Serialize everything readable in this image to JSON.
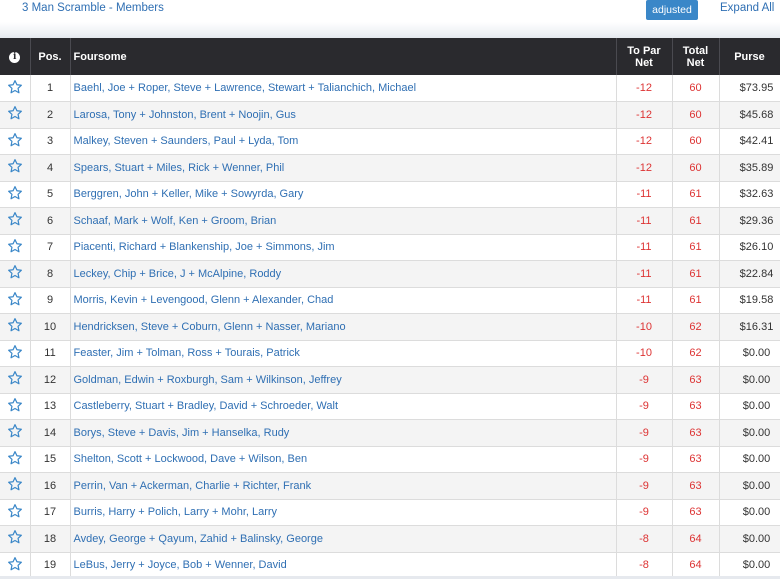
{
  "header": {
    "title": "3 Man Scramble - Members",
    "adjusted_label": "adjusted",
    "expand_label": "Expand All"
  },
  "table": {
    "columns": {
      "info": "i",
      "pos": "Pos.",
      "foursome": "Foursome",
      "to_par_line1": "To Par",
      "to_par_line2": "Net",
      "total_line1": "Total",
      "total_line2": "Net",
      "purse": "Purse"
    },
    "rows": [
      {
        "pos": "1",
        "team": "Baehl, Joe + Roper, Steve + Lawrence, Stewart + Talianchich, Michael",
        "to_par": "-12",
        "total": "60",
        "purse": "$73.95"
      },
      {
        "pos": "2",
        "team": "Larosa, Tony + Johnston, Brent + Noojin, Gus",
        "to_par": "-12",
        "total": "60",
        "purse": "$45.68"
      },
      {
        "pos": "3",
        "team": "Malkey, Steven + Saunders, Paul + Lyda, Tom",
        "to_par": "-12",
        "total": "60",
        "purse": "$42.41"
      },
      {
        "pos": "4",
        "team": "Spears, Stuart + Miles, Rick + Wenner, Phil",
        "to_par": "-12",
        "total": "60",
        "purse": "$35.89"
      },
      {
        "pos": "5",
        "team": "Berggren, John + Keller, Mike + Sowyrda, Gary",
        "to_par": "-11",
        "total": "61",
        "purse": "$32.63"
      },
      {
        "pos": "6",
        "team": "Schaaf, Mark + Wolf, Ken + Groom, Brian",
        "to_par": "-11",
        "total": "61",
        "purse": "$29.36"
      },
      {
        "pos": "7",
        "team": "Piacenti, Richard + Blankenship, Joe + Simmons, Jim",
        "to_par": "-11",
        "total": "61",
        "purse": "$26.10"
      },
      {
        "pos": "8",
        "team": "Leckey, Chip + Brice, J + McAlpine, Roddy",
        "to_par": "-11",
        "total": "61",
        "purse": "$22.84"
      },
      {
        "pos": "9",
        "team": "Morris, Kevin + Levengood, Glenn + Alexander, Chad",
        "to_par": "-11",
        "total": "61",
        "purse": "$19.58"
      },
      {
        "pos": "10",
        "team": "Hendricksen, Steve + Coburn, Glenn + Nasser, Mariano",
        "to_par": "-10",
        "total": "62",
        "purse": "$16.31"
      },
      {
        "pos": "11",
        "team": "Feaster, Jim + Tolman, Ross + Tourais, Patrick",
        "to_par": "-10",
        "total": "62",
        "purse": "$0.00"
      },
      {
        "pos": "12",
        "team": "Goldman, Edwin + Roxburgh, Sam + Wilkinson, Jeffrey",
        "to_par": "-9",
        "total": "63",
        "purse": "$0.00"
      },
      {
        "pos": "13",
        "team": "Castleberry, Stuart + Bradley, David + Schroeder, Walt",
        "to_par": "-9",
        "total": "63",
        "purse": "$0.00"
      },
      {
        "pos": "14",
        "team": "Borys, Steve + Davis, Jim + Hanselka, Rudy",
        "to_par": "-9",
        "total": "63",
        "purse": "$0.00"
      },
      {
        "pos": "15",
        "team": "Shelton, Scott + Lockwood, Dave + Wilson, Ben",
        "to_par": "-9",
        "total": "63",
        "purse": "$0.00"
      },
      {
        "pos": "16",
        "team": "Perrin, Van + Ackerman, Charlie + Richter, Frank",
        "to_par": "-9",
        "total": "63",
        "purse": "$0.00"
      },
      {
        "pos": "17",
        "team": "Burris, Harry + Polich, Larry + Mohr, Larry",
        "to_par": "-9",
        "total": "63",
        "purse": "$0.00"
      },
      {
        "pos": "18",
        "team": "Avdey, George + Qayum, Zahid + Balinsky, George",
        "to_par": "-8",
        "total": "64",
        "purse": "$0.00"
      },
      {
        "pos": "19",
        "team": "LeBus, Jerry + Joyce, Bob + Wenner, David",
        "to_par": "-8",
        "total": "64",
        "purse": "$0.00"
      }
    ]
  },
  "colors": {
    "link": "#2f6fb3",
    "header_bg": "#2a2a2e",
    "score_red": "#dd3333",
    "button_blue": "#3a87c8",
    "star_outline": "#3a87c8"
  },
  "icons": {
    "info": "info-icon",
    "favorite": "star-outline-icon"
  }
}
